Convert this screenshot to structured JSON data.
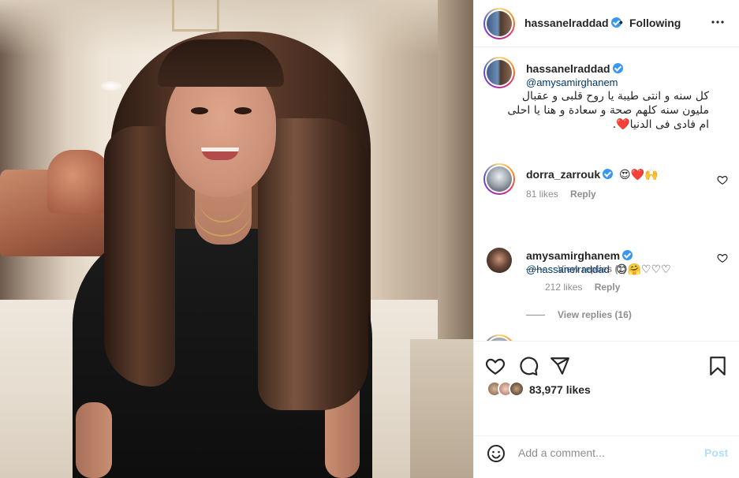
{
  "post": {
    "author": "hassanelraddad",
    "follow_status": "Following",
    "separator": "•"
  },
  "caption": {
    "username": "hassanelraddad",
    "mention": "@amysamirghanem",
    "text": "كل سنه و انتى طيبة يا روح قلبى و عقبال مليون سنه كلهم صحة و سعادة و هنا يا احلى ام فادى فى الدنيا❤️."
  },
  "comments": [
    {
      "username": "dorra_zarrouk",
      "text": "",
      "emojis": "😍❤️🙌",
      "likes": "81 likes",
      "reply_label": "Reply",
      "view_replies": "View replies (1)"
    },
    {
      "username": "amysamirghanem",
      "mention": "@hassanelraddad",
      "emojis": "😊🤗♡♡♡",
      "likes": "212 likes",
      "reply_label": "Reply",
      "view_replies": "View replies (16)"
    }
  ],
  "engagement": {
    "likes_count": "83,977 likes"
  },
  "composer": {
    "placeholder": "Add a comment...",
    "post_label": "Post"
  },
  "colors": {
    "link": "#00376b",
    "verified": "#3897f0",
    "muted": "#8e8e8e",
    "post_disabled": "#b2dffc"
  },
  "icons": {
    "more": "more-horizontal-icon",
    "like": "heart-icon",
    "comment": "comment-icon",
    "share": "share-icon",
    "save": "bookmark-icon",
    "emoji": "emoji-icon",
    "verified": "verified-badge-icon"
  }
}
